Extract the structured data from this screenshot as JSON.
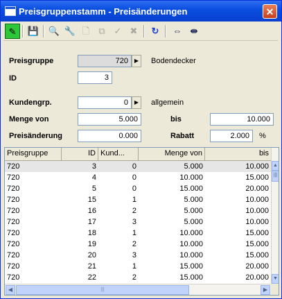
{
  "window": {
    "title": "Preisgruppenstamm - Preisänderungen",
    "close_glyph": "✕"
  },
  "toolbar": [
    {
      "icon": "edit-pencil-icon",
      "glyph": "✎",
      "state": "active"
    },
    {
      "icon": "save-disk-icon",
      "glyph": "💾",
      "state": "normal"
    },
    {
      "icon": "binoculars-search-icon",
      "glyph": "🔍",
      "state": "normal"
    },
    {
      "icon": "wrench-icon",
      "glyph": "🔧",
      "state": "disabled"
    },
    {
      "icon": "new-document-icon",
      "glyph": "🗋",
      "state": "disabled"
    },
    {
      "icon": "copy-icon",
      "glyph": "⧉",
      "state": "disabled"
    },
    {
      "icon": "apply-icon",
      "glyph": "✓",
      "state": "disabled"
    },
    {
      "icon": "delete-x-icon",
      "glyph": "✖",
      "state": "disabled"
    },
    {
      "icon": "refresh-icon",
      "glyph": "↻",
      "state": "normal"
    },
    {
      "icon": "column-width-icon",
      "glyph": "⇔",
      "state": "normal"
    },
    {
      "icon": "fit-columns-icon",
      "glyph": "⇹",
      "state": "normal"
    }
  ],
  "form": {
    "preisgruppe": {
      "label": "Preisgruppe",
      "value": "720",
      "description": "Bodendecker"
    },
    "id": {
      "label": "ID",
      "value": "3"
    },
    "kundengrp": {
      "label": "Kundengrp.",
      "value": "0",
      "description": "allgemein"
    },
    "menge_von": {
      "label": "Menge von",
      "value": "5.000"
    },
    "bis": {
      "label": "bis",
      "value": "10.000"
    },
    "preisaenderung": {
      "label": "Preisänderung",
      "value": "0.000"
    },
    "rabatt": {
      "label": "Rabatt",
      "value": "2.000",
      "unit": "%"
    },
    "arrow_glyph": "▶"
  },
  "grid": {
    "columns": [
      "Preisgruppe",
      "ID",
      "Kund...",
      "Menge von",
      "bis"
    ],
    "rows": [
      [
        "720",
        "3",
        "0",
        "5.000",
        "10.000"
      ],
      [
        "720",
        "4",
        "0",
        "10.000",
        "15.000"
      ],
      [
        "720",
        "5",
        "0",
        "15.000",
        "20.000"
      ],
      [
        "720",
        "15",
        "1",
        "5.000",
        "10.000"
      ],
      [
        "720",
        "16",
        "2",
        "5.000",
        "10.000"
      ],
      [
        "720",
        "17",
        "3",
        "5.000",
        "10.000"
      ],
      [
        "720",
        "18",
        "1",
        "10.000",
        "15.000"
      ],
      [
        "720",
        "19",
        "2",
        "10.000",
        "15.000"
      ],
      [
        "720",
        "20",
        "3",
        "10.000",
        "15.000"
      ],
      [
        "720",
        "21",
        "1",
        "15.000",
        "20.000"
      ],
      [
        "720",
        "22",
        "2",
        "15.000",
        "20.000"
      ]
    ],
    "selected_row": 0,
    "scroll": {
      "up": "▲",
      "down": "▼",
      "left": "◀",
      "right": "▶",
      "grip": "|||"
    }
  }
}
